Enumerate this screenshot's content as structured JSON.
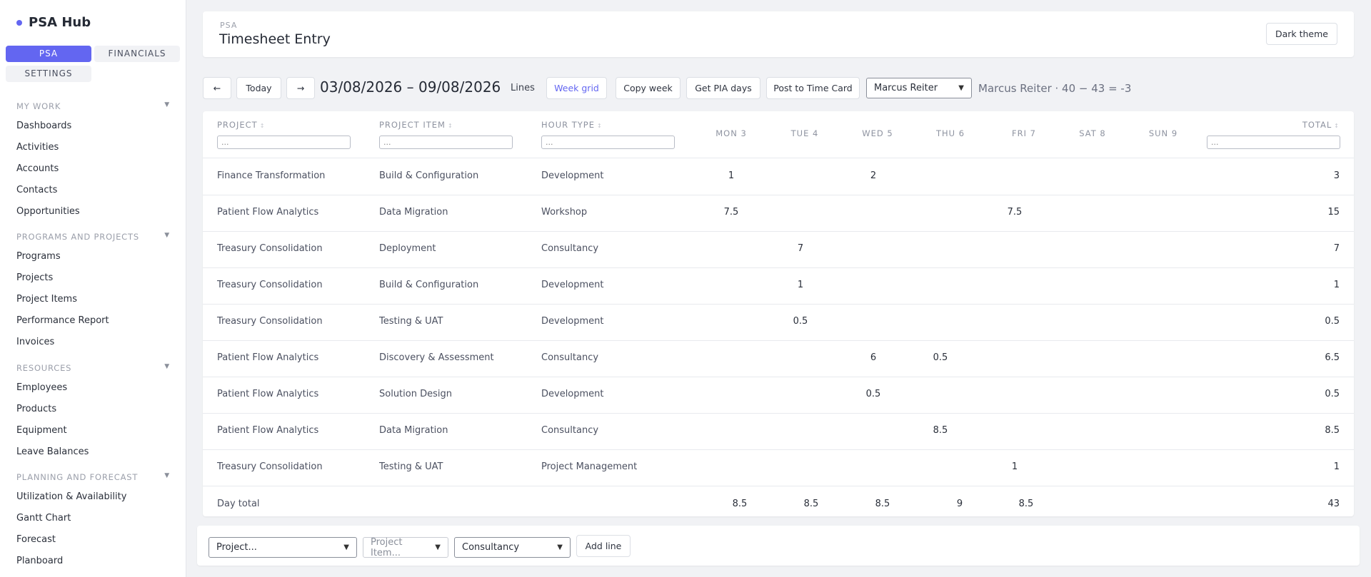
{
  "sidebar": {
    "brand": "PSA Hub",
    "tabs": {
      "psa": "PSA",
      "financials": "FINANCIALS",
      "settings": "SETTINGS"
    },
    "sections": [
      {
        "title": "MY WORK",
        "items": [
          "Dashboards",
          "Activities",
          "Accounts",
          "Contacts",
          "Opportunities"
        ]
      },
      {
        "title": "PROGRAMS AND PROJECTS",
        "items": [
          "Programs",
          "Projects",
          "Project Items",
          "Performance Report",
          "Invoices"
        ]
      },
      {
        "title": "RESOURCES",
        "items": [
          "Employees",
          "Products",
          "Equipment",
          "Leave Balances"
        ]
      },
      {
        "title": "PLANNING AND FORECAST",
        "items": [
          "Utilization & Availability",
          "Gantt Chart",
          "Forecast",
          "Planboard"
        ]
      }
    ],
    "caret": "▼"
  },
  "header": {
    "crumb": "PSA",
    "title": "Timesheet Entry",
    "theme_button": "Dark theme"
  },
  "toolbar": {
    "prev": "←",
    "today": "Today",
    "next": "→",
    "date_range": "03/08/2026 – 09/08/2026",
    "lines_label": "Lines",
    "week_grid": "Week grid",
    "copy_week": "Copy week",
    "get_pia": "Get PIA days",
    "post_timecard": "Post to Time Card",
    "employee": "Marcus Reiter",
    "summary": "Marcus Reiter · 40 − 43 = -3"
  },
  "grid": {
    "headers": {
      "project": "PROJECT",
      "project_item": "PROJECT ITEM",
      "hour_type": "HOUR TYPE",
      "days": [
        "MON 3",
        "TUE 4",
        "WED 5",
        "THU 6",
        "FRI 7",
        "SAT 8",
        "SUN 9"
      ],
      "total": "TOTAL"
    },
    "sort_glyph": "↕",
    "filter_placeholder": "...",
    "rows": [
      {
        "project": "Finance Transformation",
        "item": "Build & Configuration",
        "type": "Development",
        "days": [
          "1",
          "",
          "2",
          "",
          "",
          "",
          ""
        ],
        "total": "3"
      },
      {
        "project": "Patient Flow Analytics",
        "item": "Data Migration",
        "type": "Workshop",
        "days": [
          "7.5",
          "",
          "",
          "",
          "7.5",
          "",
          ""
        ],
        "total": "15"
      },
      {
        "project": "Treasury Consolidation",
        "item": "Deployment",
        "type": "Consultancy",
        "days": [
          "",
          "7",
          "",
          "",
          "",
          "",
          ""
        ],
        "total": "7"
      },
      {
        "project": "Treasury Consolidation",
        "item": "Build & Configuration",
        "type": "Development",
        "days": [
          "",
          "1",
          "",
          "",
          "",
          "",
          ""
        ],
        "total": "1"
      },
      {
        "project": "Treasury Consolidation",
        "item": "Testing & UAT",
        "type": "Development",
        "days": [
          "",
          "0.5",
          "",
          "",
          "",
          "",
          ""
        ],
        "total": "0.5"
      },
      {
        "project": "Patient Flow Analytics",
        "item": "Discovery & Assessment",
        "type": "Consultancy",
        "days": [
          "",
          "",
          "6",
          "0.5",
          "",
          "",
          ""
        ],
        "total": "6.5"
      },
      {
        "project": "Patient Flow Analytics",
        "item": "Solution Design",
        "type": "Development",
        "days": [
          "",
          "",
          "0.5",
          "",
          "",
          "",
          ""
        ],
        "total": "0.5"
      },
      {
        "project": "Patient Flow Analytics",
        "item": "Data Migration",
        "type": "Consultancy",
        "days": [
          "",
          "",
          "",
          "8.5",
          "",
          "",
          ""
        ],
        "total": "8.5"
      },
      {
        "project": "Treasury Consolidation",
        "item": "Testing & UAT",
        "type": "Project Management",
        "days": [
          "",
          "",
          "",
          "",
          "1",
          "",
          ""
        ],
        "total": "1"
      }
    ],
    "day_total": {
      "label": "Day total",
      "days": [
        "8.5",
        "8.5",
        "8.5",
        "9",
        "8.5",
        "",
        ""
      ],
      "total": "43"
    }
  },
  "add_line": {
    "project_select": "Project...",
    "item_select": "Project Item...",
    "type_select": "Consultancy",
    "add_button": "Add line"
  },
  "colors": {
    "accent": "#6366f1",
    "background": "#f1f2f5"
  }
}
